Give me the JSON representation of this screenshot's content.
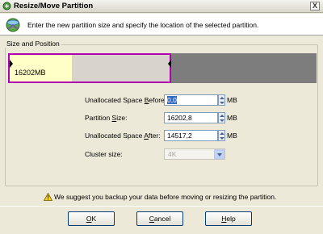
{
  "window": {
    "title": "Resize/Move Partition",
    "close_label": "X"
  },
  "header": {
    "description": "Enter the new partition size and specify the location of the selected partition."
  },
  "group": {
    "legend": "Size and Position"
  },
  "partition_bar": {
    "size_label": "16202MB",
    "used_fraction": 0.38,
    "partition_fraction": 0.53,
    "colors": {
      "used": "#ffffc8",
      "free_in_partition": "#d8d4cc",
      "unallocated": "#7d7d7d",
      "border": "#b000b0"
    }
  },
  "form": {
    "unalloc_before": {
      "label_pre": "Unallocated Space ",
      "label_u": "B",
      "label_post": "efore:",
      "value": "0,0",
      "unit": "MB"
    },
    "partition_size": {
      "label_pre": "Partition ",
      "label_u": "S",
      "label_post": "ize:",
      "value": "16202,8",
      "unit": "MB"
    },
    "unalloc_after": {
      "label_pre": "Unallocated Space ",
      "label_u": "A",
      "label_post": "fter:",
      "value": "14517,2",
      "unit": "MB"
    },
    "cluster_size": {
      "label": "Cluster size:",
      "value": "4K"
    }
  },
  "warning": {
    "text": "We suggest you backup your data before moving or resizing the partition.",
    "icon": "warning-icon"
  },
  "buttons": {
    "ok": {
      "u": "O",
      "rest": "K"
    },
    "cancel": {
      "u": "C",
      "rest": "ancel"
    },
    "help": {
      "u": "H",
      "rest": "elp"
    }
  }
}
